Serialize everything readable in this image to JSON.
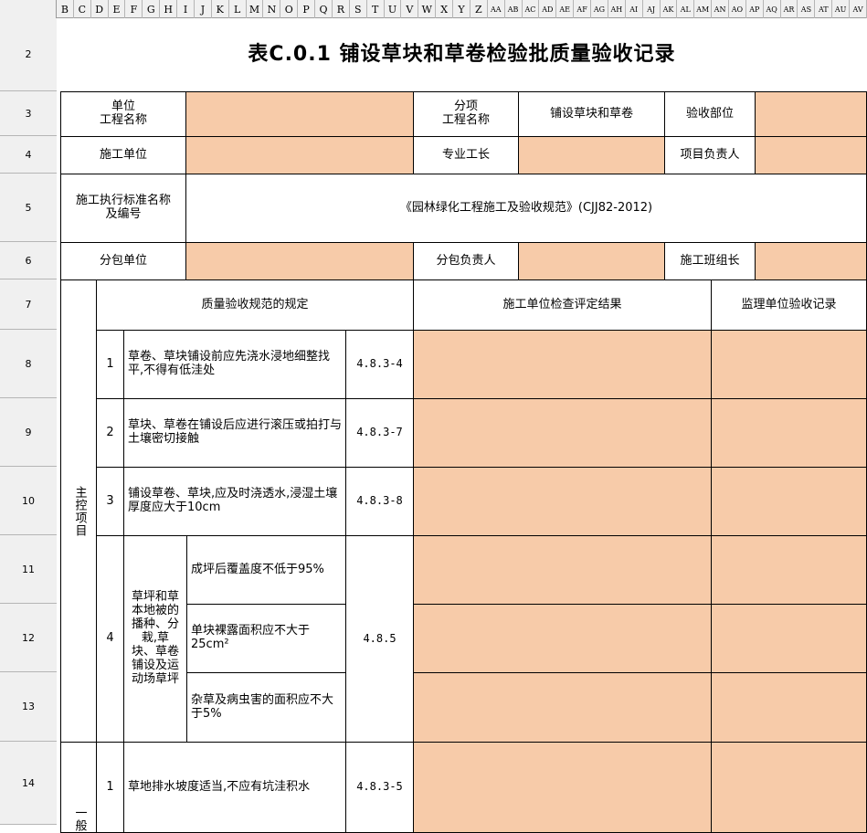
{
  "columns": [
    "B",
    "C",
    "D",
    "E",
    "F",
    "G",
    "H",
    "I",
    "J",
    "K",
    "L",
    "M",
    "N",
    "O",
    "P",
    "Q",
    "R",
    "S",
    "T",
    "U",
    "V",
    "W",
    "X",
    "Y",
    "Z",
    "AA",
    "AB",
    "AC",
    "AD",
    "AE",
    "AF",
    "AG",
    "AH",
    "AI",
    "AJ",
    "AK",
    "AL",
    "AM",
    "AN",
    "AO",
    "AP",
    "AQ",
    "AR",
    "AS",
    "AT",
    "AU",
    "AV"
  ],
  "rows": [
    "2",
    "3",
    "4",
    "5",
    "6",
    "7",
    "8",
    "9",
    "10",
    "11",
    "12",
    "13",
    "14"
  ],
  "title": "表C.0.1 铺设草块和草卷检验批质量验收记录",
  "header": {
    "unit_project_name_label": "单位\n工程名称",
    "sub_project_name_label": "分项\n工程名称",
    "sub_project_name_value": "铺设草块和草卷",
    "inspection_part_label": "验收部位",
    "construction_unit_label": "施工单位",
    "foreman_label": "专业工长",
    "project_leader_label": "项目负责人",
    "standard_label": "施工执行标准名称\n及编号",
    "standard_value": "《园林绿化工程施工及验收规范》(CJJ82-2012)",
    "subcontract_unit_label": "分包单位",
    "subcontract_leader_label": "分包负责人",
    "team_leader_label": "施工班组长"
  },
  "columns_header": {
    "spec": "质量验收规范的规定",
    "construction_result": "施工单位检查评定结果",
    "supervision_record": "监理单位验收记录"
  },
  "main_items_label": "主控项目",
  "general_items_label": "一般",
  "items": [
    {
      "no": "1",
      "text": "草卷、草块铺设前应先浇水浸地细整找平,不得有低洼处",
      "clause": "4.8.3-4"
    },
    {
      "no": "2",
      "text": "草块、草卷在铺设后应进行滚压或拍打与土壤密切接触",
      "clause": "4.8.3-7"
    },
    {
      "no": "3",
      "text": "铺设草卷、草块,应及时浇透水,浸湿土壤厚度应大于10cm",
      "clause": "4.8.3-8"
    },
    {
      "no": "4",
      "group": "草坪和草本地被的播种、分栽,草块、草卷铺设及运动场草坪",
      "clause": "4.8.5",
      "subs": [
        "成坪后覆盖度不低于95%",
        "单块裸露面积应不大于25cm²",
        "杂草及病虫害的面积应不大于5%"
      ]
    }
  ],
  "general_items": [
    {
      "no": "1",
      "text": "草地排水坡度适当,不应有坑洼积水",
      "clause": "4.8.3-5"
    }
  ]
}
